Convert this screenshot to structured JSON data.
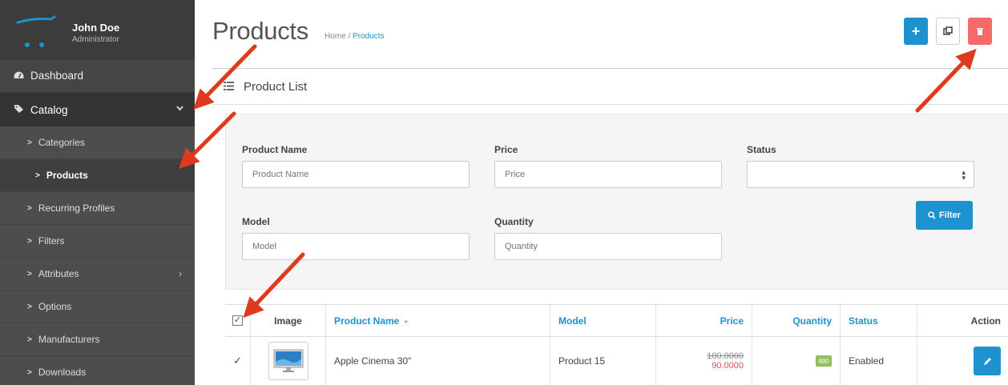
{
  "user": {
    "name": "John Doe",
    "role": "Administrator"
  },
  "nav": {
    "dashboard": "Dashboard",
    "catalog": "Catalog",
    "sub_items": [
      {
        "label": "Categories"
      },
      {
        "label": "Products"
      },
      {
        "label": "Recurring Profiles"
      },
      {
        "label": "Filters"
      },
      {
        "label": "Attributes"
      },
      {
        "label": "Options"
      },
      {
        "label": "Manufacturers"
      },
      {
        "label": "Downloads"
      }
    ]
  },
  "header": {
    "title": "Products",
    "breadcrumb_home": "Home",
    "breadcrumb_sep": "/",
    "breadcrumb_current": "Products"
  },
  "panel": {
    "title": "Product List"
  },
  "filter": {
    "product_name_label": "Product Name",
    "product_name_placeholder": "Product Name",
    "price_label": "Price",
    "price_placeholder": "Price",
    "status_label": "Status",
    "status_value": "",
    "model_label": "Model",
    "model_placeholder": "Model",
    "quantity_label": "Quantity",
    "quantity_placeholder": "Quantity",
    "filter_button": "Filter"
  },
  "table": {
    "headers": [
      "Image",
      "Product Name",
      "Model",
      "Price",
      "Quantity",
      "Status",
      "Action"
    ],
    "sort_indicator": "⌄",
    "rows": [
      {
        "name": "Apple Cinema 30\"",
        "model": "Product 15",
        "old_price": "100.0000",
        "price": "90.0000",
        "quantity": "990",
        "status": "Enabled"
      }
    ]
  },
  "colors": {
    "sidebar_bg": "#454545",
    "accent": "#1e91cf",
    "danger": "#f56b6b",
    "arrow": "#e03a1e"
  },
  "icons": {
    "add": "plus-icon",
    "copy": "copy-icon",
    "delete": "trash-icon",
    "filter": "search-icon",
    "edit": "pencil-icon"
  }
}
